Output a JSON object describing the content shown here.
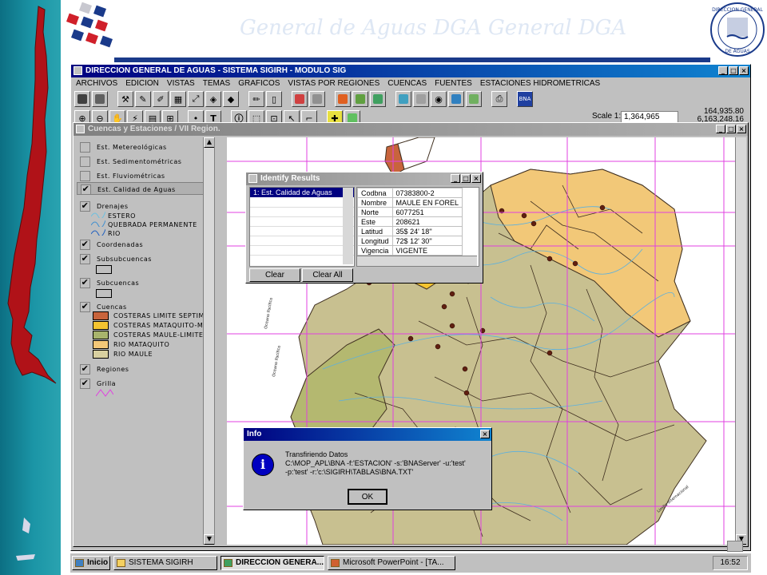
{
  "app": {
    "window_title": "DIRECCION GENERAL DE AGUAS - SISTEMA SIGIRH - MODULO SIG",
    "menu": [
      "ARCHIVOS",
      "EDICION",
      "VISTAS",
      "TEMAS",
      "GRAFICOS",
      "VISTAS POR REGIONES",
      "CUENCAS",
      "FUENTES",
      "ESTACIONES HIDROMETRICAS"
    ],
    "scale_label": "Scale 1:",
    "scale_value": "1,364,965",
    "coord_x": "164,935.80",
    "coord_y": "6,163,248.16",
    "window_buttons": [
      "_",
      "□",
      "×"
    ]
  },
  "slide": {
    "watermark": "General de Aguas   DGA   General   DGA",
    "seal_top_text": "DIRECCION GENERAL",
    "seal_bottom_text": "DE AGUAS"
  },
  "view": {
    "title": "Cuencas y Estaciones / VII Region.",
    "legend": [
      {
        "label": "Est. Metereológicas",
        "checked": false
      },
      {
        "label": "Est. Sedimentométricas",
        "checked": false
      },
      {
        "label": "Est. Fluviométricas",
        "checked": false
      },
      {
        "label": "Est. Calidad de Aguas",
        "checked": true
      },
      {
        "label": "Drenajes",
        "checked": true
      },
      {
        "label": "Coordenadas",
        "checked": true
      },
      {
        "label": "Subsubcuencas",
        "checked": true
      },
      {
        "label": "Subcuencas",
        "checked": true
      },
      {
        "label": "Cuencas",
        "checked": true
      },
      {
        "label": "Regiones",
        "checked": true
      },
      {
        "label": "Grilla",
        "checked": true
      }
    ],
    "drenajes_items": [
      "ESTERO",
      "QUEBRADA PERMANENTE",
      "RIO"
    ],
    "cuencas_items": [
      {
        "label": "COSTERAS LIMITE SEPTIM",
        "color": "#c8643c"
      },
      {
        "label": "COSTERAS MATAQUITO-M",
        "color": "#f4c430"
      },
      {
        "label": "COSTERAS MAULE-LIMITE",
        "color": "#a8b46c"
      },
      {
        "label": "RIO MATAQUITO",
        "color": "#f4c878"
      },
      {
        "label": "RIO MAULE",
        "color": "#d8d0a0"
      }
    ]
  },
  "identify": {
    "title": "Identify Results",
    "list_item": "1:  Est. Calidad de Aguas",
    "rows": [
      {
        "field": "Codbna",
        "value": "07383800-2"
      },
      {
        "field": "Nombre",
        "value": "MAULE EN FOREL"
      },
      {
        "field": "Norte",
        "value": "6077251"
      },
      {
        "field": "Este",
        "value": "208621"
      },
      {
        "field": "Latitud",
        "value": "35$ 24' 18''"
      },
      {
        "field": "Longitud",
        "value": "72$ 12' 30''"
      },
      {
        "field": "Vigencia",
        "value": "VIGENTE"
      }
    ],
    "clear_button": "Clear",
    "clear_all_button": "Clear All"
  },
  "info_dialog": {
    "title": "Info",
    "message_line1": "Transfiriendo Datos",
    "message_line2": "C:\\MOP_APL\\BNA -f:'ESTACION' -s:'BNAServer' -u:'test'",
    "message_line3": "-p:'test' -r:'c:\\SIGIRH\\TABLAS\\BNA.TXT'",
    "ok_button": "OK",
    "close": "×"
  },
  "map_labels": {
    "coast_label_1": "Oceano Pacifico",
    "coast_label_2": "Oceano Pacifico",
    "east_label": "Limite Internacional"
  },
  "taskbar": {
    "start": "Inicio",
    "buttons": [
      "SISTEMA SIGIRH",
      "DIRECCION GENERA...",
      "Microsoft PowerPoint - [TA..."
    ],
    "clock": "16:52"
  },
  "colors": {
    "titlebar": "#000080",
    "grid": "#e040e0",
    "maule": "#c8c090",
    "mataquito": "#f2c878",
    "costera": "#b4b870"
  }
}
